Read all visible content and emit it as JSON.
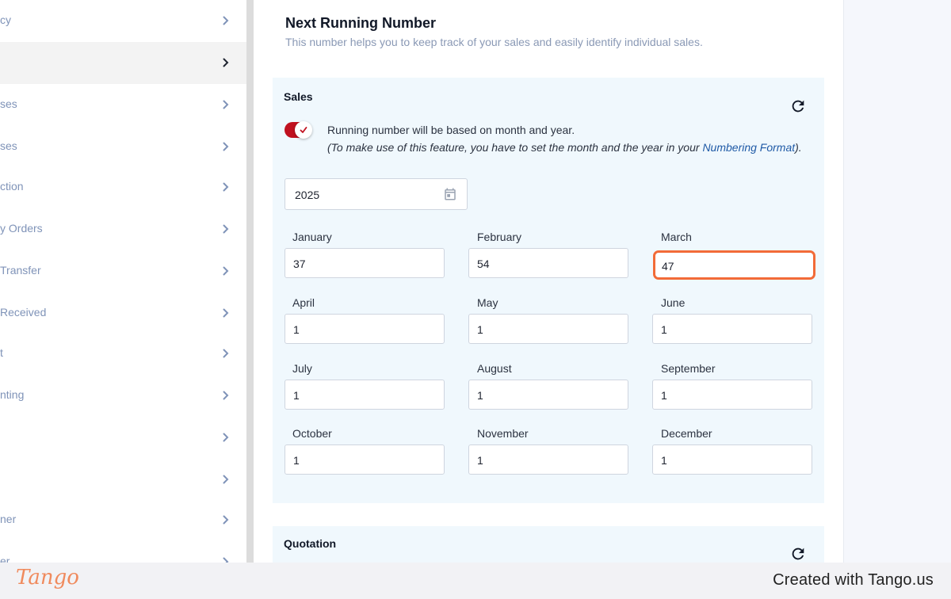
{
  "sidebar": {
    "items": [
      {
        "label": "cy",
        "active": false
      },
      {
        "label": "",
        "active": true
      },
      {
        "label": "ses",
        "active": false
      },
      {
        "label": "ses",
        "active": false
      },
      {
        "label": "ction",
        "active": false
      },
      {
        "label": "y Orders",
        "active": false
      },
      {
        "label": "Transfer",
        "active": false
      },
      {
        "label": " Received",
        "active": false
      },
      {
        "label": "t",
        "active": false
      },
      {
        "label": "nting",
        "active": false
      },
      {
        "label": "",
        "active": false
      },
      {
        "label": "",
        "active": false
      },
      {
        "label": "ner",
        "active": false
      },
      {
        "label": "er",
        "active": false
      }
    ]
  },
  "main": {
    "title": "Next Running Number",
    "subtitle": "This number helps you to keep track of your sales and easily identify individual sales."
  },
  "sales": {
    "title": "Sales",
    "toggle_on": true,
    "toggle_text": "Running number will be based on month and year.",
    "note_prefix": "(To make use of this feature, you have to set the month and the year in your ",
    "note_link": "Numbering Format",
    "note_suffix": ").",
    "year": "2025",
    "months": [
      {
        "label": "January",
        "value": "37"
      },
      {
        "label": "February",
        "value": "54"
      },
      {
        "label": "March",
        "value": "47"
      },
      {
        "label": "April",
        "value": "1"
      },
      {
        "label": "May",
        "value": "1"
      },
      {
        "label": "June",
        "value": "1"
      },
      {
        "label": "July",
        "value": "1"
      },
      {
        "label": "August",
        "value": "1"
      },
      {
        "label": "September",
        "value": "1"
      },
      {
        "label": "October",
        "value": "1"
      },
      {
        "label": "November",
        "value": "1"
      },
      {
        "label": "December",
        "value": "1"
      }
    ]
  },
  "quotation": {
    "title": "Quotation"
  },
  "footer": {
    "logo": "Tango",
    "credit": "Created with Tango.us"
  },
  "colors": {
    "toggle": "#c0111f",
    "highlight": "#f26b38",
    "link": "#1f5aa6"
  },
  "icons": {
    "chevron": "chevron-right-icon",
    "refresh": "refresh-icon",
    "calendar": "calendar-icon",
    "check": "check-icon"
  }
}
